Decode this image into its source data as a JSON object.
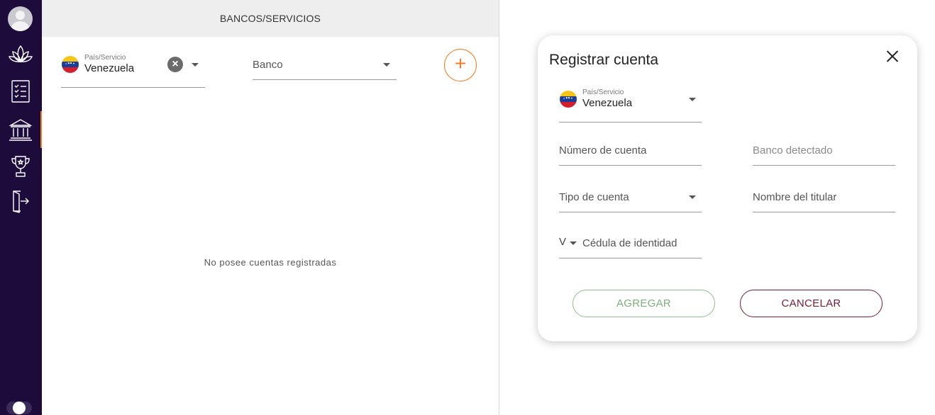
{
  "sidebar": {
    "items": [
      {
        "icon": "user-avatar"
      },
      {
        "icon": "lotus-icon"
      },
      {
        "icon": "checklist-icon"
      },
      {
        "icon": "bank-icon",
        "active": true
      },
      {
        "icon": "trophy-icon"
      },
      {
        "icon": "logout-icon"
      }
    ],
    "accent_color": "#f47b20"
  },
  "main": {
    "title": "BANCOS/SERVICIOS",
    "country_filter": {
      "label": "País/Servicio",
      "value": "Venezuela"
    },
    "bank_filter": {
      "placeholder": "Banco"
    },
    "add_button": "+",
    "empty_message": "No posee cuentas registradas"
  },
  "modal": {
    "title": "Registrar cuenta",
    "country": {
      "label": "País/Servicio",
      "value": "Venezuela"
    },
    "account_number": {
      "placeholder": "Número de cuenta"
    },
    "bank_detected": {
      "placeholder": "Banco detectado"
    },
    "account_type": {
      "placeholder": "Tipo de cuenta"
    },
    "holder_name": {
      "placeholder": "Nombre del titular"
    },
    "id_type": {
      "value": "V"
    },
    "id_number": {
      "placeholder": "Cédula de identidad"
    },
    "add_label": "AGREGAR",
    "cancel_label": "CANCELAR"
  },
  "colors": {
    "sidebar_bg": "#1c0b3b",
    "accent": "#f47b20",
    "add_green": "#79b079",
    "cancel_red": "#7a1c33"
  }
}
